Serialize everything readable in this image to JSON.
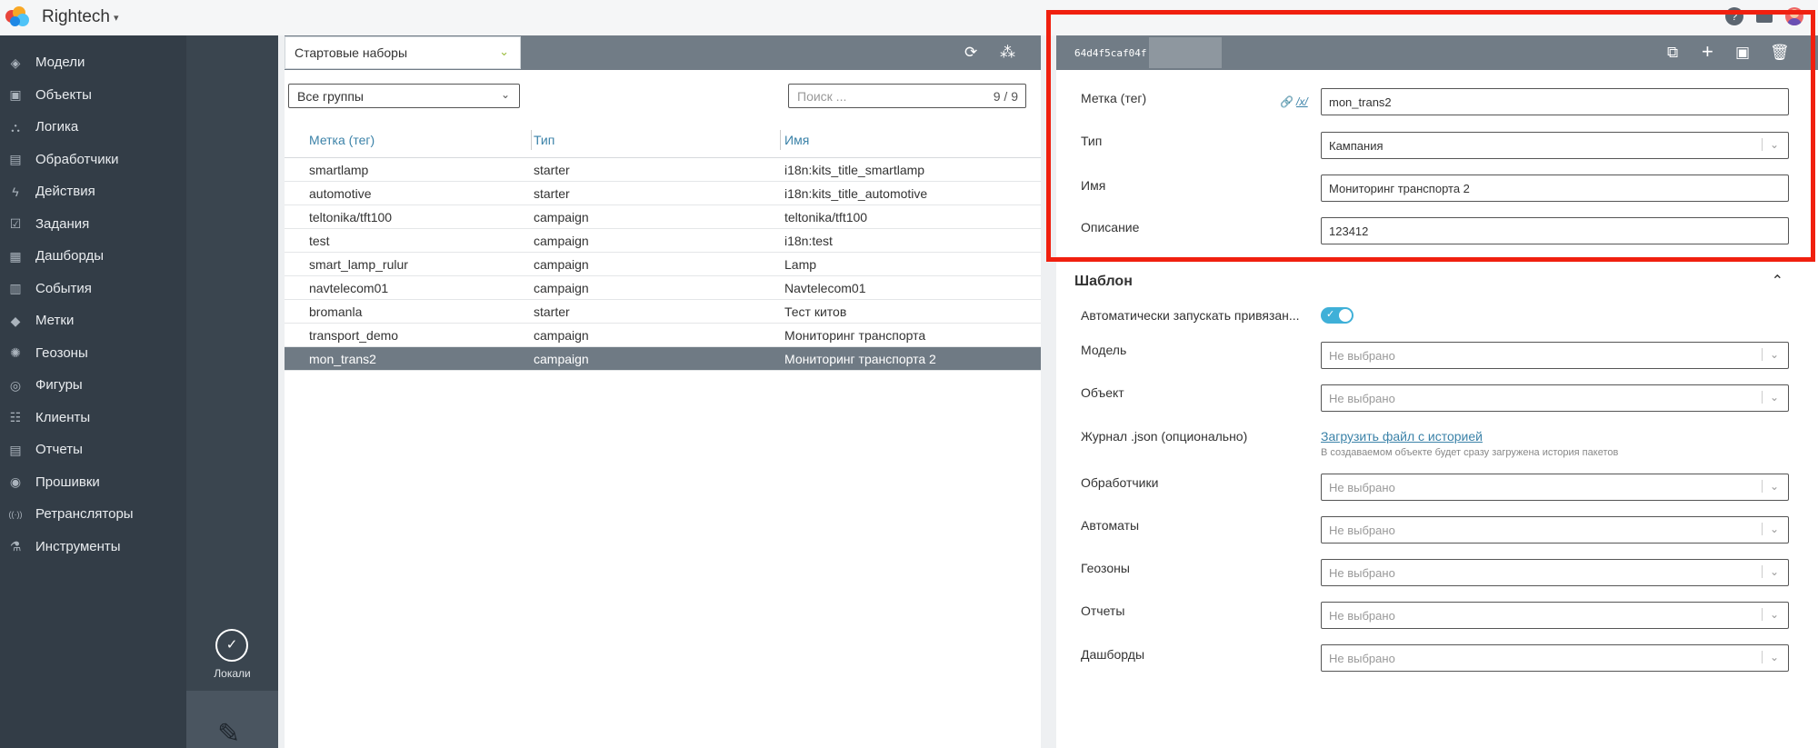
{
  "app": {
    "title": "Rightech",
    "caret": "▾",
    "logo_colors": [
      "#e8453c",
      "#f9a825",
      "#4fc3f7",
      "#1e88e5"
    ]
  },
  "top_icons": [
    "help-icon",
    "mail-icon",
    "user-avatar"
  ],
  "sidebar": {
    "items": [
      {
        "label": "Модели",
        "icon": "cube-icon"
      },
      {
        "label": "Объекты",
        "icon": "object-icon"
      },
      {
        "label": "Логика",
        "icon": "logic-icon"
      },
      {
        "label": "Обработчики",
        "icon": "handler-icon"
      },
      {
        "label": "Действия",
        "icon": "lightning-icon"
      },
      {
        "label": "Задания",
        "icon": "task-icon"
      },
      {
        "label": "Дашборды",
        "icon": "dashboard-icon"
      },
      {
        "label": "События",
        "icon": "event-icon"
      },
      {
        "label": "Метки",
        "icon": "tag-icon"
      },
      {
        "label": "Геозоны",
        "icon": "geozone-icon"
      },
      {
        "label": "Фигуры",
        "icon": "figure-icon"
      },
      {
        "label": "Клиенты",
        "icon": "clients-icon"
      },
      {
        "label": "Отчеты",
        "icon": "report-icon"
      },
      {
        "label": "Прошивки",
        "icon": "firmware-icon"
      },
      {
        "label": "Ретрансляторы",
        "icon": "antenna-icon"
      },
      {
        "label": "Инструменты",
        "icon": "tools-icon"
      }
    ]
  },
  "col2": {
    "local_label": "Локали",
    "local_check": "✓",
    "pencil": "✎"
  },
  "list_panel": {
    "set_select": "Стартовые наборы",
    "group_select": "Все группы",
    "search_placeholder": "Поиск ...",
    "search_count": "9 / 9",
    "columns": [
      "Метка (тег)",
      "Тип",
      "Имя"
    ],
    "rows": [
      {
        "tag": "smartlamp",
        "type": "starter",
        "name": "i18n:kits_title_smartlamp"
      },
      {
        "tag": "automotive",
        "type": "starter",
        "name": "i18n:kits_title_automotive"
      },
      {
        "tag": "teltonika/tft100",
        "type": "campaign",
        "name": "teltonika/tft100"
      },
      {
        "tag": "test",
        "type": "campaign",
        "name": "i18n:test"
      },
      {
        "tag": "smart_lamp_rulur",
        "type": "campaign",
        "name": "Lamp"
      },
      {
        "tag": "navtelecom01",
        "type": "campaign",
        "name": "Navtelecom01"
      },
      {
        "tag": "bromanla",
        "type": "starter",
        "name": "Тест китов"
      },
      {
        "tag": "transport_demo",
        "type": "campaign",
        "name": "Мониторинг транспорта"
      },
      {
        "tag": "mon_trans2",
        "type": "campaign",
        "name": "Мониторинг транспорта 2"
      }
    ],
    "selected_index": 8
  },
  "detail": {
    "id": "64d4f5caf04f",
    "tag_label": "Метка (тег)",
    "regex_link": "/x/",
    "tag_value": "mon_trans2",
    "type_label": "Тип",
    "type_value": "Кампания",
    "name_label": "Имя",
    "name_value": "Мониторинг транспорта 2",
    "desc_label": "Описание",
    "desc_value": "123412",
    "template_title": "Шаблон",
    "auto_start_label": "Автоматически запускать привязан...",
    "model_label": "Модель",
    "object_label": "Объект",
    "journal_label": "Журнал .json (опционально)",
    "upload_link": "Загрузить файл с историей",
    "upload_hint": "В создаваемом объекте будет сразу загружена история пакетов",
    "handlers_label": "Обработчики",
    "automata_label": "Автоматы",
    "geozones_label": "Геозоны",
    "reports_label": "Отчеты",
    "dashboards_label": "Дашборды",
    "not_selected": "Не выбрано"
  },
  "highlight_color": "#f0200f"
}
